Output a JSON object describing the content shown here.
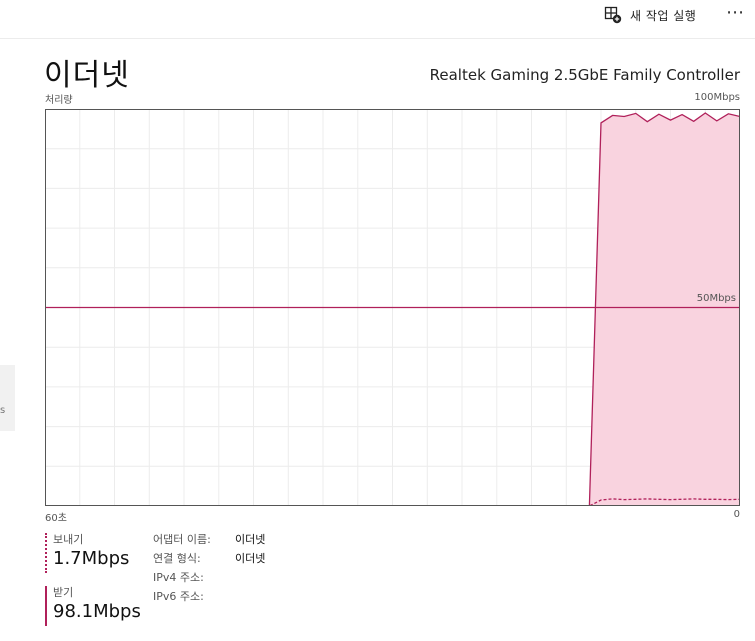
{
  "toolbar": {
    "run_task_label": "새 작업 실행",
    "run_task_icon": "run-new-task-icon",
    "more_icon": "more-options-icon",
    "more_label": "⋯"
  },
  "page": {
    "title": "이더넷",
    "adapter": "Realtek Gaming 2.5GbE Family Controller"
  },
  "chart_data": {
    "type": "area",
    "title": "",
    "ylabel": "처리량",
    "y_max_label": "100Mbps",
    "y_mid_label": "50Mbps",
    "x_left_label": "60초",
    "x_right_label": "0",
    "x_unit": "seconds ago",
    "y_unit": "Mbps",
    "ylim": [
      0,
      100
    ],
    "xlim": [
      60,
      0
    ],
    "grid": true,
    "colors": {
      "line": "#b0205a",
      "fill": "#f9d3df",
      "grid": "#ececec",
      "border": "#555555"
    },
    "series": [
      {
        "name": "받기",
        "style": "solid",
        "x": [
          60,
          59,
          58,
          57,
          56,
          55,
          54,
          53,
          52,
          51,
          50,
          49,
          48,
          47,
          46,
          45,
          44,
          43,
          42,
          41,
          40,
          39,
          38,
          37,
          36,
          35,
          34,
          33,
          32,
          31,
          30,
          29,
          28,
          27,
          26,
          25,
          24,
          23,
          22,
          21,
          20,
          19,
          18,
          17,
          16,
          15,
          14,
          13,
          12,
          11,
          10,
          9,
          8,
          7,
          6,
          5,
          4,
          3,
          2,
          1,
          0
        ],
        "values": [
          0,
          0,
          0,
          0,
          0,
          0,
          0,
          0,
          0,
          0,
          0,
          0,
          0,
          0,
          0,
          0,
          0,
          0,
          0,
          0,
          0,
          0,
          0,
          0,
          0,
          0,
          0,
          0,
          0,
          0,
          0,
          0,
          0,
          0,
          0,
          0,
          0,
          0,
          0,
          0,
          0,
          0,
          0,
          0,
          0,
          0,
          0,
          0,
          96.5,
          98.4,
          98.1,
          98.9,
          96.8,
          98.7,
          97.2,
          98.6,
          96.9,
          99.0,
          97.0,
          98.8,
          98.1
        ]
      },
      {
        "name": "보내기",
        "style": "dotted",
        "x": [
          60,
          59,
          58,
          57,
          56,
          55,
          54,
          53,
          52,
          51,
          50,
          49,
          48,
          47,
          46,
          45,
          44,
          43,
          42,
          41,
          40,
          39,
          38,
          37,
          36,
          35,
          34,
          33,
          32,
          31,
          30,
          29,
          28,
          27,
          26,
          25,
          24,
          23,
          22,
          21,
          20,
          19,
          18,
          17,
          16,
          15,
          14,
          13,
          12,
          11,
          10,
          9,
          8,
          7,
          6,
          5,
          4,
          3,
          2,
          1,
          0
        ],
        "values": [
          0,
          0,
          0,
          0,
          0,
          0,
          0,
          0,
          0,
          0,
          0,
          0,
          0,
          0,
          0,
          0,
          0,
          0,
          0,
          0,
          0,
          0,
          0,
          0,
          0,
          0,
          0,
          0,
          0,
          0,
          0,
          0,
          0,
          0,
          0,
          0,
          0,
          0,
          0,
          0,
          0,
          0,
          0,
          0,
          0,
          0,
          0,
          0,
          1.5,
          1.8,
          1.6,
          1.7,
          1.8,
          1.7,
          1.6,
          1.7,
          1.8,
          1.7,
          1.7,
          1.6,
          1.7
        ]
      }
    ]
  },
  "stats": {
    "send_label": "보내기",
    "send_value": "1.7Mbps",
    "recv_label": "받기",
    "recv_value": "98.1Mbps"
  },
  "properties": [
    {
      "key": "어댑터 이름:",
      "value": "이더넷"
    },
    {
      "key": "연결 형식:",
      "value": "이더넷"
    },
    {
      "key": "IPv4 주소:",
      "value": ""
    },
    {
      "key": "IPv6 주소:",
      "value": ""
    }
  ],
  "sidebar_fragment": "s"
}
